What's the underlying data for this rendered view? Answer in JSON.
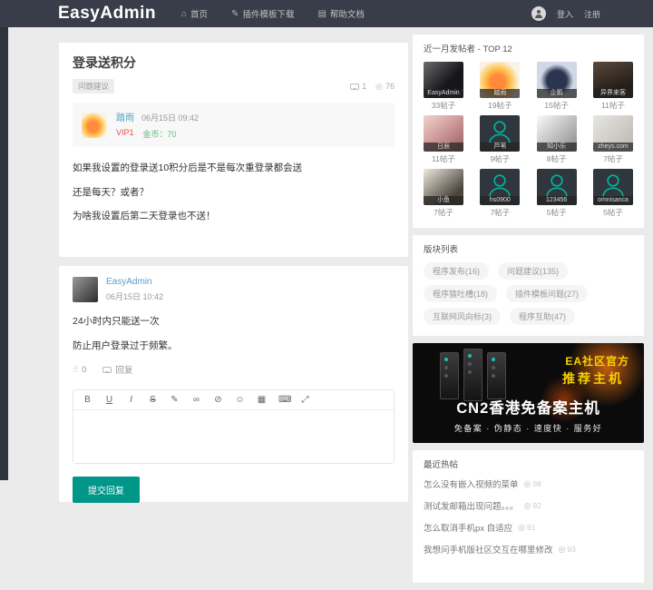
{
  "colors": {
    "header_bg": "#393D49",
    "accent_teal": "#009688",
    "link_blue": "#58a0c8",
    "vip_red": "#e0504d",
    "coin_green": "#5FB878",
    "ad_yellow": "#f8d000",
    "page_bg": "#ebebeb"
  },
  "header": {
    "logo": "EasyAdmin",
    "nav": [
      {
        "label": "首页",
        "icon": "⌂"
      },
      {
        "label": "插件模板下载",
        "icon": "✎"
      },
      {
        "label": "帮助文档",
        "icon": "▤"
      }
    ],
    "login": "登入",
    "register": "注册"
  },
  "post": {
    "title": "登录送积分",
    "category": "问题建议",
    "comments": "1",
    "views": "76",
    "author": {
      "name": "踏雨",
      "date": "06月15日 09:42",
      "vip": "VIP1",
      "coins": "金币：70"
    },
    "paragraphs": [
      "如果我设置的登录送10积分后是不是每次重登录都会送",
      "还是每天？或者？",
      "为啥我设置后第二天登录也不送！"
    ]
  },
  "reply": {
    "author": "EasyAdmin",
    "date": "06月15日 10:42",
    "paragraphs": [
      "24小时内只能送一次",
      "防止用户登录过于频繁。"
    ],
    "likes": "0",
    "reply_label": "回复"
  },
  "editor": {
    "tools": [
      {
        "glyph": "B",
        "name": "bold"
      },
      {
        "glyph": "U",
        "name": "underline"
      },
      {
        "glyph": "I",
        "name": "italic"
      },
      {
        "glyph": "S",
        "name": "strikethrough"
      },
      {
        "glyph": "✎",
        "name": "pencil"
      },
      {
        "glyph": "∞",
        "name": "link"
      },
      {
        "glyph": "⊘",
        "name": "unlink"
      },
      {
        "glyph": "☺",
        "name": "emoji"
      },
      {
        "glyph": "▦",
        "name": "image"
      },
      {
        "glyph": "⌨",
        "name": "code"
      },
      {
        "glyph": "⤢",
        "name": "fullscreen"
      }
    ],
    "submit": "提交回复"
  },
  "sidebar": {
    "top_posters": {
      "title": "近一月发帖者 - TOP 12",
      "users": [
        {
          "name": "EasyAdmin",
          "posts": "33帖子"
        },
        {
          "name": "踏雨",
          "posts": "19帖子"
        },
        {
          "name": "企鹅",
          "posts": "15帖子"
        },
        {
          "name": "异界来客",
          "posts": "11帖子"
        },
        {
          "name": "日辰",
          "posts": "11帖子"
        },
        {
          "name": "芦苇",
          "posts": "9帖子"
        },
        {
          "name": "知小乐",
          "posts": "8帖子"
        },
        {
          "name": "zheys.com",
          "posts": "7帖子"
        },
        {
          "name": "小鱼",
          "posts": "7帖子"
        },
        {
          "name": "hs0900",
          "posts": "7帖子"
        },
        {
          "name": "123456",
          "posts": "5帖子"
        },
        {
          "name": "omnisanca",
          "posts": "5帖子"
        }
      ]
    },
    "boards": {
      "title": "版块列表",
      "items": [
        "程序发布(16)",
        "问题建议(135)",
        "程序猿吐槽(18)",
        "插件模板问题(27)",
        "互联网风向标(3)",
        "程序互助(47)"
      ]
    },
    "ad": {
      "line1": "EA社区官方",
      "line2": "推荐主机",
      "line3": "CN2香港免备案主机",
      "line4": "免备案 · 伪静态 · 速度快 · 服务好"
    },
    "hot": {
      "title": "最近热帖",
      "items": [
        {
          "title": "怎么没有嵌入视频的菜单",
          "views": "98"
        },
        {
          "title": "测试发邮箱出现问题。。。",
          "views": "92"
        },
        {
          "title": "怎么取消手机px 自适应",
          "views": "91"
        },
        {
          "title": "我想问手机版社区交互在哪里修改",
          "views": "93"
        }
      ]
    }
  }
}
